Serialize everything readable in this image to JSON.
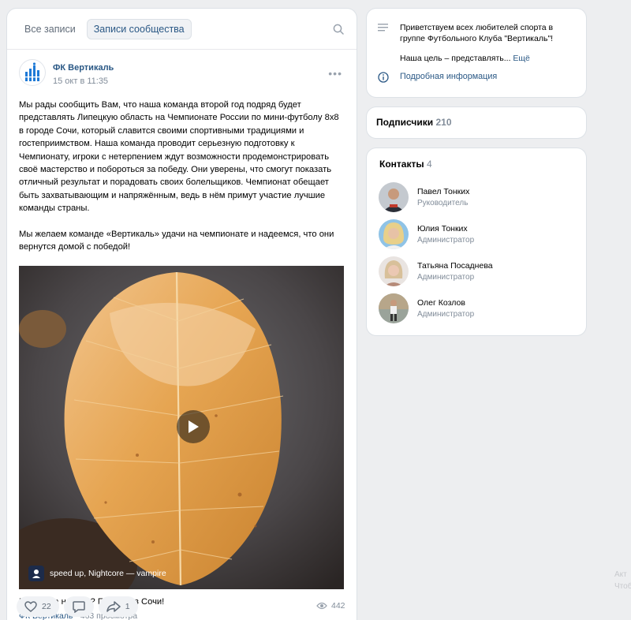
{
  "tabs": {
    "all": "Все записи",
    "community": "Записи сообщества"
  },
  "post": {
    "author": "ФК Вертикаль",
    "date": "15 окт в 11:35",
    "paragraphs": [
      "Мы рады сообщить Вам, что наша команда второй год подряд будет представлять Липецкую область на Чемпионате России по мини-футболу 8х8 в городе Сочи, который славится своими спортивными традициями и гостеприимством. Наша команда проводит серьезную подготовку к Чемпионату, игроки с нетерпением ждут возможности продемонстрировать своё мастерство и побороться за победу. Они уверены, что смогут показать отличный результат и порадовать своих болельщиков. Чемпионат обещает быть захватывающим и напряжённым, ведь в нём примут участие лучшие команды страны.",
      "Мы желаем команде «Вертикаль» удачи на чемпионате и надеемся, что они вернутся домой с победой!"
    ],
    "video": {
      "audio_label": "speed up, Nightcore — vampire"
    },
    "caption": "Планы на ноябрь? Поездка в Сочи!",
    "meta_source": "ФК Вертикаль",
    "meta_views": " · 463 просмотра",
    "likes": "22",
    "shares": "1",
    "views": "442"
  },
  "info": {
    "greeting": "Приветствуем всех любителей спорта в группе Футбольного Клуба \"Вертикаль\"!",
    "goal": "Наша цель – представлять...",
    "more": "Ещё",
    "details": "Подробная информация"
  },
  "subscribers": {
    "label": "Подписчики",
    "count": "210"
  },
  "contacts": {
    "label": "Контакты",
    "count": "4",
    "items": [
      {
        "name": "Павел Тонких",
        "role": "Руководитель"
      },
      {
        "name": "Юлия Тонких",
        "role": "Администратор"
      },
      {
        "name": "Татьяна Посаднева",
        "role": "Администратор"
      },
      {
        "name": "Олег Козлов",
        "role": "Администратор"
      }
    ]
  },
  "watermark": {
    "line1": "Акт",
    "line2": "Чтоб"
  },
  "colors": {
    "link": "#2a5885",
    "muted": "#818c99",
    "background": "#edeef0"
  }
}
